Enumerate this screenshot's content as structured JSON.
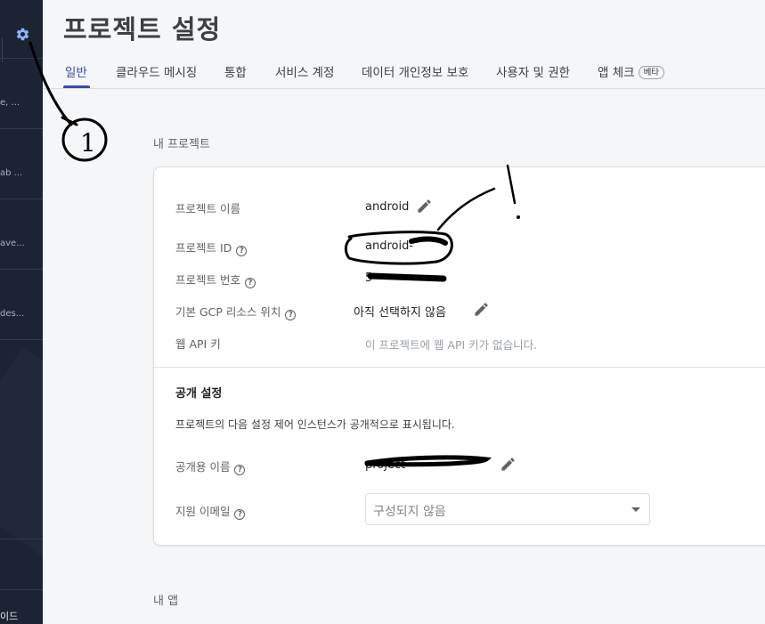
{
  "page_title": "프로젝트 설정",
  "tabs": [
    {
      "label": "일반",
      "active": true
    },
    {
      "label": "클라우드 메시징"
    },
    {
      "label": "통합"
    },
    {
      "label": "서비스 계정"
    },
    {
      "label": "데이터 개인정보 보호"
    },
    {
      "label": "사용자 및 권한"
    },
    {
      "label": "앱 체크",
      "badge": "베타"
    }
  ],
  "sidebar": {
    "fragments": [
      "e, ...",
      "ab ...",
      "ave...",
      "des..."
    ],
    "bottom_text": "이드"
  },
  "my_project": {
    "section_label": "내 프로젝트",
    "rows": [
      {
        "label": "프로젝트 이름",
        "value": "android"
      },
      {
        "label": "프로젝트 ID",
        "value": "android-"
      },
      {
        "label": "프로젝트 번호",
        "value": "5"
      },
      {
        "label": "기본 GCP 리소스 위치",
        "value": "아직 선택하지 않음"
      },
      {
        "label": "웹 API 키",
        "value": "이 프로젝트에 웹 API 키가 없습니다."
      }
    ],
    "public_settings": {
      "title": "공개 설정",
      "description": "프로젝트의 다음 설정 제어 인스턴스가 공개적으로 표시됩니다.",
      "public_name_label": "공개용 이름",
      "public_name_value": "project-",
      "support_email_label": "지원 이메일",
      "support_email_value": "구성되지 않음"
    }
  },
  "my_apps": {
    "section_label": "내 앱"
  },
  "annotations": {
    "circle_number": "1",
    "exclamation": "!"
  },
  "colors": {
    "sidebar_bg": "#1c2333",
    "accent": "#3949ab",
    "gear": "#8ab4f8"
  }
}
